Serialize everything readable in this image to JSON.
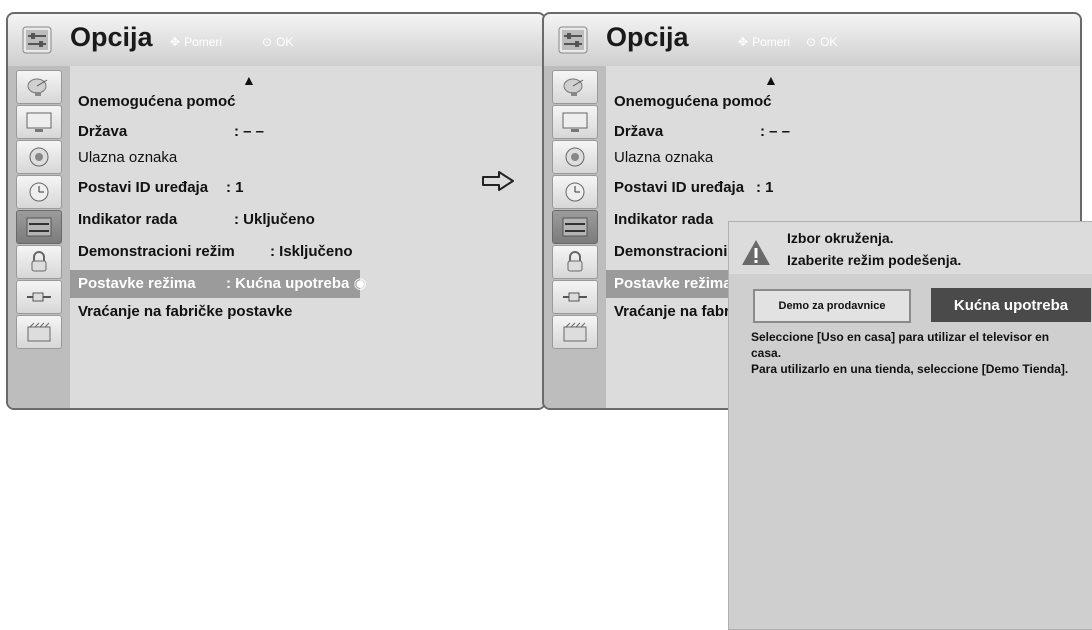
{
  "left_panel": {
    "title": "Opcija",
    "hint_move": "Pomeri",
    "hint_ok": "OK",
    "up_arrow": "▲",
    "items": [
      {
        "label": "Onemogućena pomoć",
        "value": ""
      },
      {
        "label": "Država",
        "value": ": – –"
      },
      {
        "label": "Ulazna oznaka",
        "value": ""
      },
      {
        "label": "Postavi ID uređaja",
        "value": ": 1"
      },
      {
        "label": "Indikator rada",
        "value": ": Uključeno"
      },
      {
        "label": "Demonstracioni režim",
        "value": ": Isključeno"
      },
      {
        "label": "Postavke režima",
        "value": ": Kućna upotreba ◉"
      },
      {
        "label": "Vraćanje na fabričke postavke",
        "value": ""
      }
    ]
  },
  "right_panel": {
    "title": "Opcija",
    "hint_move": "Pomeri",
    "hint_ok": "OK",
    "up_arrow": "▲",
    "items": [
      {
        "label": "Onemogućena pomoć",
        "value": ""
      },
      {
        "label": "Država",
        "value": ": – –"
      },
      {
        "label": "Ulazna oznaka",
        "value": ""
      },
      {
        "label": "Postavi ID uređaja",
        "value": ": 1"
      },
      {
        "label": "Indikator rada",
        "value": ""
      },
      {
        "label": "Demonstracioni",
        "value": ""
      },
      {
        "label": "Postavke režima",
        "value": ""
      },
      {
        "label": "Vraćanje na fabr",
        "value": ""
      }
    ]
  },
  "popup": {
    "line1": "Izbor okruženja.",
    "line2": "Izaberite režim podešenja.",
    "demo_button": "Demo za prodavnice",
    "home_button": "Kućna upotreba",
    "note1": "Seleccione [Uso en casa] para utilizar el televisor en",
    "note2": "casa.",
    "note3": "Para utilizarlo en una tienda, seleccione [Demo Tienda]."
  },
  "icons": [
    "satellite-dish-icon",
    "tv-screen-icon",
    "speaker-icon",
    "clock-icon",
    "option-icon",
    "lock-icon",
    "input-plug-icon",
    "media-icon"
  ],
  "colors": {
    "selected_row": "#9b9b9b",
    "home_button": "#4a4a4a"
  }
}
